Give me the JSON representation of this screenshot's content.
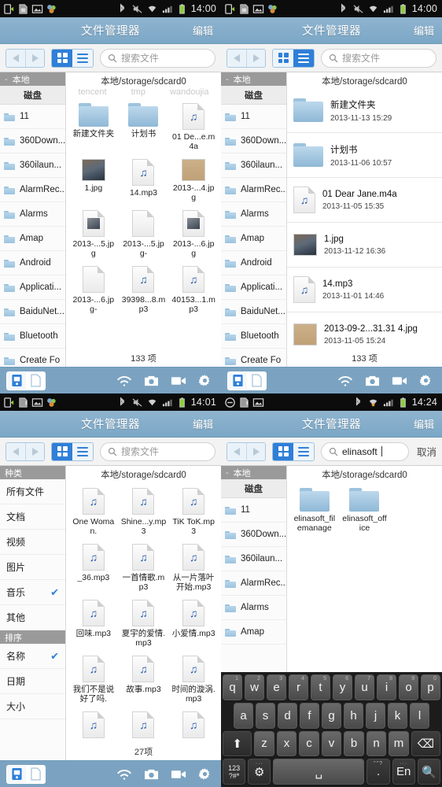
{
  "app": {
    "title": "文件管理器",
    "edit_label": "编辑"
  },
  "search": {
    "placeholder": "搜索文件",
    "query": "elinasoft",
    "cancel_label": "取消",
    "icon": "search-icon"
  },
  "status_bars": [
    {
      "time": "14:00",
      "left_icons": [
        "usb-debug-icon",
        "sdcard-icon",
        "gallery-icon",
        "apps-icon"
      ],
      "right_icons": [
        "bluetooth-icon",
        "mute-icon",
        "wifi-icon",
        "signal-icon",
        "battery-icon"
      ]
    },
    {
      "time": "14:00",
      "left_icons": [
        "usb-debug-icon",
        "sdcard-icon",
        "gallery-icon",
        "apps-icon"
      ],
      "right_icons": [
        "bluetooth-icon",
        "mute-icon",
        "wifi-icon",
        "signal-icon",
        "battery-icon"
      ]
    },
    {
      "time": "14:01",
      "left_icons": [
        "usb-debug-icon",
        "sdcard-warning-icon",
        "gallery-icon",
        "apps-icon"
      ],
      "right_icons": [
        "bluetooth-icon",
        "mute-icon",
        "wifi-icon",
        "signal-icon",
        "battery-icon"
      ]
    },
    {
      "time": "14:24",
      "left_icons": [
        "do-not-disturb-icon",
        "sdcard-warning-icon",
        "gallery-icon"
      ],
      "right_icons": [
        "bluetooth-icon",
        "wifi-alert-icon",
        "signal-icon",
        "battery-icon"
      ]
    }
  ],
  "toolbar": {
    "back_icon": "back-arrow-icon",
    "forward_icon": "forward-arrow-icon",
    "grid_view_icon": "grid-view-icon",
    "list_view_icon": "list-view-icon"
  },
  "bottombar": {
    "device_icon": "device-storage-icon",
    "file_icon": "file-page-icon",
    "wifi_icon": "wifi-share-icon",
    "camera_icon": "camera-icon",
    "video_icon": "video-camera-icon",
    "settings_icon": "gear-icon"
  },
  "panel1": {
    "view_mode": "grid",
    "path": "本地/storage/sdcard0",
    "ghost_labels": [
      "tencent",
      "tmp",
      "wandoujia"
    ],
    "sidebar": {
      "header": "本地",
      "subheader": "磁盘",
      "items": [
        "11",
        "360Down...",
        "360ilaun...",
        "AlarmRec...",
        "Alarms",
        "Amap",
        "Android",
        "Applicati...",
        "BaiduNet...",
        "Bluetooth",
        "Create Fo"
      ]
    },
    "files": [
      {
        "name": "新建文件夹",
        "icon": "folder-icon"
      },
      {
        "name": "计划书",
        "icon": "folder-icon"
      },
      {
        "name": "01 De...e.m4a",
        "icon": "audio-file-icon"
      },
      {
        "name": "1.jpg",
        "icon": "image-thumb-icon"
      },
      {
        "name": "14.mp3",
        "icon": "audio-file-icon"
      },
      {
        "name": "2013-...4.jpg",
        "icon": "image-tan-icon"
      },
      {
        "name": "2013-...5.jpg",
        "icon": "image-thumb-small-icon"
      },
      {
        "name": "2013-...5.jpg-",
        "icon": "blank-file-icon"
      },
      {
        "name": "2013-...6.jpg",
        "icon": "image-thumb-small-icon"
      },
      {
        "name": "2013-...6.jpg-",
        "icon": "blank-file-icon"
      },
      {
        "name": "39398...8.mp3",
        "icon": "audio-file-icon"
      },
      {
        "name": "40153...1.mp3",
        "icon": "audio-file-icon"
      }
    ],
    "count": "133 项"
  },
  "panel2": {
    "view_mode": "list",
    "path": "本地/storage/sdcard0",
    "sidebar": {
      "header": "本地",
      "subheader": "磁盘",
      "items": [
        "11",
        "360Down...",
        "360ilaun...",
        "AlarmRec...",
        "Alarms",
        "Amap",
        "Android",
        "Applicati...",
        "BaiduNet...",
        "Bluetooth",
        "Create Fo"
      ]
    },
    "files": [
      {
        "name": "新建文件夹",
        "date": "2013-11-13 15:29",
        "icon": "folder-icon"
      },
      {
        "name": "计划书",
        "date": "2013-11-06 10:57",
        "icon": "folder-icon"
      },
      {
        "name": "01 Dear Jane.m4a",
        "date": "2013-11-05 15:35",
        "icon": "audio-file-icon"
      },
      {
        "name": "1.jpg",
        "date": "2013-11-12 16:36",
        "icon": "image-thumb-icon"
      },
      {
        "name": "14.mp3",
        "date": "2013-11-01 14:46",
        "icon": "audio-file-icon"
      },
      {
        "name": "2013-09-2...31.31 4.jpg",
        "date": "2013-11-05 15:24",
        "icon": "image-tan-icon"
      }
    ],
    "count": "133 项"
  },
  "panel3": {
    "view_mode": "grid",
    "path": "本地/storage/sdcard0",
    "sidebar": {
      "header_category": "种类",
      "header_sort": "排序",
      "categories": [
        {
          "label": "所有文件",
          "checked": false
        },
        {
          "label": "文档",
          "checked": false
        },
        {
          "label": "视频",
          "checked": false
        },
        {
          "label": "图片",
          "checked": false
        },
        {
          "label": "音乐",
          "checked": true
        },
        {
          "label": "其他",
          "checked": false
        }
      ],
      "sorts": [
        {
          "label": "名称",
          "checked": true
        },
        {
          "label": "日期",
          "checked": false
        },
        {
          "label": "大小",
          "checked": false
        }
      ],
      "check_glyph": "✔"
    },
    "files": [
      {
        "name": "One Woman.",
        "icon": "audio-file-icon"
      },
      {
        "name": "Shine...y.mp3",
        "icon": "audio-file-icon"
      },
      {
        "name": "TiK ToK.mp3",
        "icon": "audio-file-icon"
      },
      {
        "name": "_36.mp3",
        "icon": "audio-file-icon"
      },
      {
        "name": "一首情歌.mp3",
        "icon": "audio-file-icon"
      },
      {
        "name": "从一片落叶开始.mp3",
        "icon": "audio-file-icon"
      },
      {
        "name": "回味.mp3",
        "icon": "audio-file-icon"
      },
      {
        "name": "夏宇的爱情.mp3",
        "icon": "audio-file-icon"
      },
      {
        "name": "小爱情.mp3",
        "icon": "audio-file-icon"
      },
      {
        "name": "我们不是说好了吗.",
        "icon": "audio-file-icon"
      },
      {
        "name": "故事.mp3",
        "icon": "audio-file-icon"
      },
      {
        "name": "时间的漩涡.mp3",
        "icon": "audio-file-icon"
      },
      {
        "name": "",
        "icon": "audio-file-icon"
      },
      {
        "name": "",
        "icon": "audio-file-icon"
      },
      {
        "name": "",
        "icon": "audio-file-icon"
      }
    ],
    "count": "27项"
  },
  "panel4": {
    "view_mode": "grid",
    "path": "本地/storage/sdcard0",
    "sidebar": {
      "header": "本地",
      "subheader": "磁盘",
      "items": [
        "11",
        "360Down...",
        "360ilaun...",
        "AlarmRec...",
        "Alarms",
        "Amap"
      ]
    },
    "files": [
      {
        "name": "elinasoft_filemanage",
        "icon": "folder-icon"
      },
      {
        "name": "elinasoft_office",
        "icon": "folder-icon"
      }
    ]
  },
  "keyboard": {
    "row1": [
      {
        "key": "q",
        "sup": "1"
      },
      {
        "key": "w",
        "sup": "2"
      },
      {
        "key": "e",
        "sup": "3"
      },
      {
        "key": "r",
        "sup": "4"
      },
      {
        "key": "t",
        "sup": "5"
      },
      {
        "key": "y",
        "sup": "6"
      },
      {
        "key": "u",
        "sup": "7"
      },
      {
        "key": "i",
        "sup": "8"
      },
      {
        "key": "o",
        "sup": "9"
      },
      {
        "key": "p",
        "sup": "0"
      }
    ],
    "row2": [
      {
        "key": "a"
      },
      {
        "key": "s"
      },
      {
        "key": "d"
      },
      {
        "key": "f"
      },
      {
        "key": "g"
      },
      {
        "key": "h"
      },
      {
        "key": "j"
      },
      {
        "key": "k"
      },
      {
        "key": "l"
      }
    ],
    "row3": [
      {
        "key": "⬆",
        "name": "shift-key"
      },
      {
        "key": "z"
      },
      {
        "key": "x"
      },
      {
        "key": "c"
      },
      {
        "key": "v"
      },
      {
        "key": "b"
      },
      {
        "key": "n"
      },
      {
        "key": "m"
      },
      {
        "key": "⌫",
        "name": "backspace-key"
      }
    ],
    "row4": [
      {
        "key": "123\n?#*",
        "name": "symbols-key"
      },
      {
        "key": "⚙",
        "name": "keyboard-settings-key",
        "dots": "···"
      },
      {
        "key": "␣",
        "name": "space-key"
      },
      {
        "key": ".",
        "name": "period-key",
        "dots": "\"\"?"
      },
      {
        "key": "En",
        "name": "language-key",
        "dots": "···"
      },
      {
        "key": "🔍",
        "name": "search-key"
      }
    ]
  }
}
